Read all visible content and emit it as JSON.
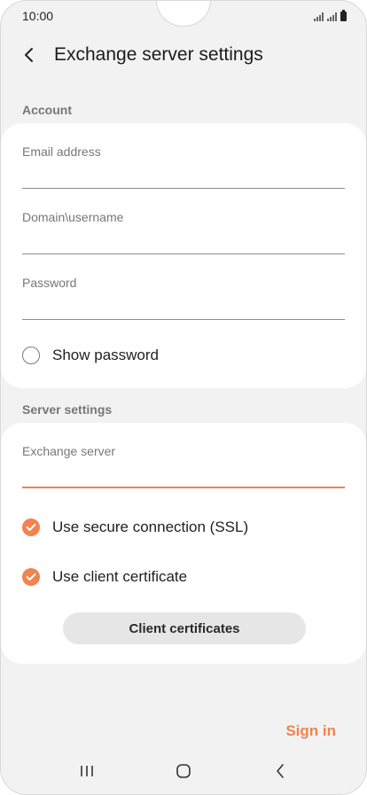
{
  "status_bar": {
    "time": "10:00"
  },
  "header": {
    "title": "Exchange server settings"
  },
  "account_section": {
    "title": "Account",
    "fields": [
      {
        "label": "Email address"
      },
      {
        "label": "Domain\\username"
      },
      {
        "label": "Password"
      }
    ],
    "show_password_label": "Show password"
  },
  "server_section": {
    "title": "Server settings",
    "exchange_server_label": "Exchange server",
    "ssl_label": "Use secure connection (SSL)",
    "client_cert_toggle_label": "Use client certificate",
    "client_cert_button_label": "Client certificates"
  },
  "footer": {
    "sign_in_label": "Sign in"
  },
  "icons": {
    "back": "chevron-left-icon",
    "recent_apps": "recent-apps-icon",
    "home": "home-icon",
    "nav_back": "back-icon"
  },
  "colors": {
    "accent": "#f0834f",
    "background": "#f2f2f2",
    "card": "#ffffff"
  }
}
